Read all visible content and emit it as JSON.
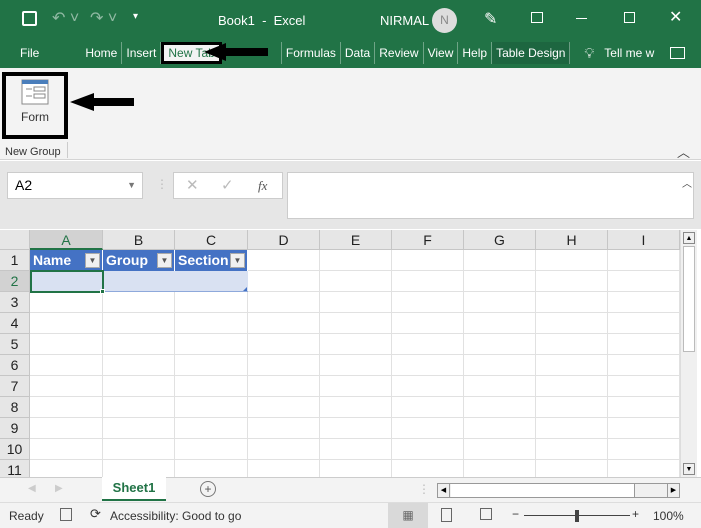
{
  "window": {
    "title": "Book1  -  Excel",
    "user": "NIRMAL",
    "avatar_initial": "N"
  },
  "tabs": [
    {
      "label": "File"
    },
    {
      "label": "Home"
    },
    {
      "label": "Insert"
    },
    {
      "label": "New Tab",
      "active": true
    },
    {
      "label": ""
    },
    {
      "label": "Formulas"
    },
    {
      "label": "Data"
    },
    {
      "label": "Review"
    },
    {
      "label": "View"
    },
    {
      "label": "Help"
    },
    {
      "label": "Table Design"
    }
  ],
  "tell_me": "Tell me w",
  "ribbon": {
    "form_label": "Form",
    "group_label": "New Group"
  },
  "formula_bar": {
    "name_box": "A2",
    "fx": "fx",
    "value": ""
  },
  "columns": [
    "A",
    "B",
    "C",
    "D",
    "E",
    "F",
    "G",
    "H",
    "I"
  ],
  "rows": [
    "1",
    "2",
    "3",
    "4",
    "5",
    "6",
    "7",
    "8",
    "9",
    "10",
    "11"
  ],
  "table": {
    "headers": [
      "Name",
      "Group",
      "Section"
    ]
  },
  "sheets": [
    {
      "label": "Sheet1",
      "active": true
    }
  ],
  "status": {
    "ready": "Ready",
    "accessibility": "Accessibility: Good to go",
    "zoom": "100%",
    "zoom_percent": 100
  },
  "colors": {
    "excel_green": "#217346",
    "table_header": "#4472c4",
    "table_row": "#d9e1f2"
  }
}
